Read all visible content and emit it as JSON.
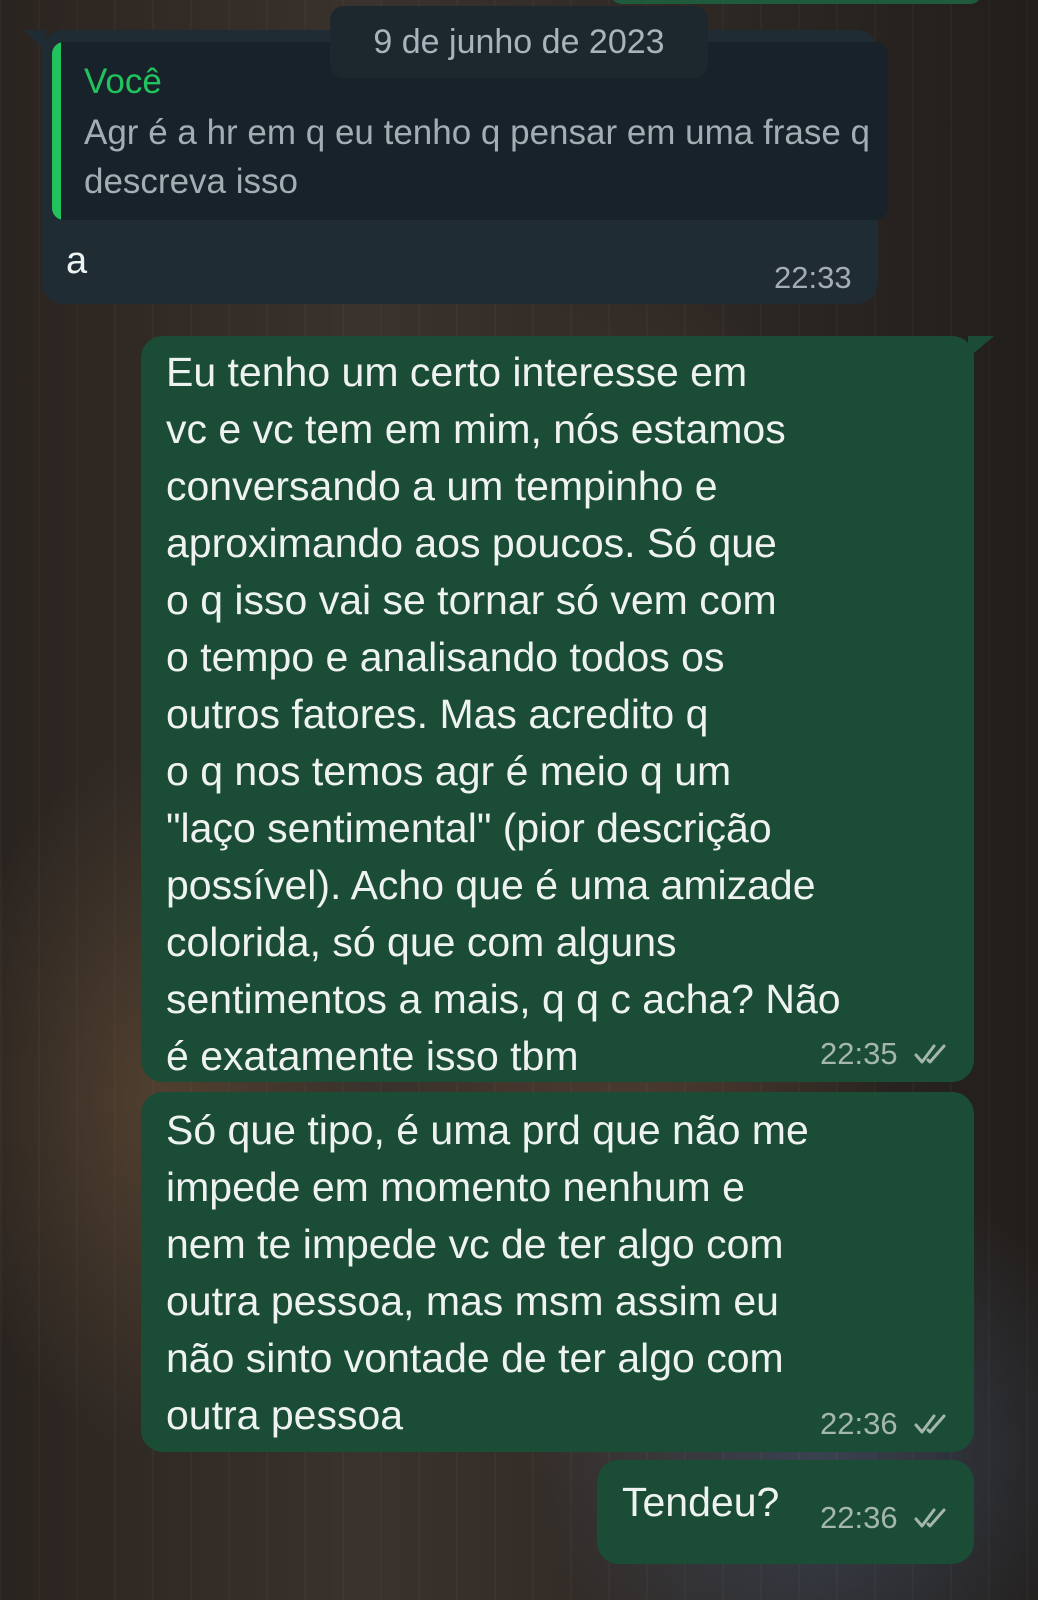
{
  "date_divider": "9 de junho de 2023",
  "messages": [
    {
      "direction": "incoming",
      "reply_quote": {
        "author": "Você",
        "text": "Agr é a hr em q eu tenho q pensar em uma frase q descreva isso"
      },
      "text": "a",
      "time": "22:33"
    },
    {
      "direction": "outgoing",
      "text": "Eu tenho um certo interesse em\nvc e vc tem em mim, nós estamos\nconversando a um tempinho e\naproximando aos poucos. Só que\no q isso vai se tornar só vem com\no tempo e analisando todos os\noutros fatores. Mas acredito q\no q nos temos agr é meio q um\n\"laço sentimental\" (pior descrição\npossível). Acho que é uma amizade\ncolorida, só que com alguns\nsentimentos a mais, q q c acha? Não\né exatamente isso tbm",
      "time": "22:35",
      "status_icon": "double-check-icon"
    },
    {
      "direction": "outgoing",
      "text": "Só que tipo, é uma prd que não me\nimpede em momento nenhum e\nnem te impede vc de ter algo com\noutra pessoa, mas msm assim eu\nnão sinto vontade de ter algo com\noutra pessoa",
      "time": "22:36",
      "status_icon": "double-check-icon"
    },
    {
      "direction": "outgoing",
      "text": "Tendeu?",
      "time": "22:36",
      "status_icon": "double-check-icon"
    }
  ],
  "colors": {
    "incoming_bubble": "#1f2c34",
    "outgoing_bubble": "#1a4c36",
    "quote_accent": "#22c35e",
    "timestamp": "#a4b6ad"
  }
}
